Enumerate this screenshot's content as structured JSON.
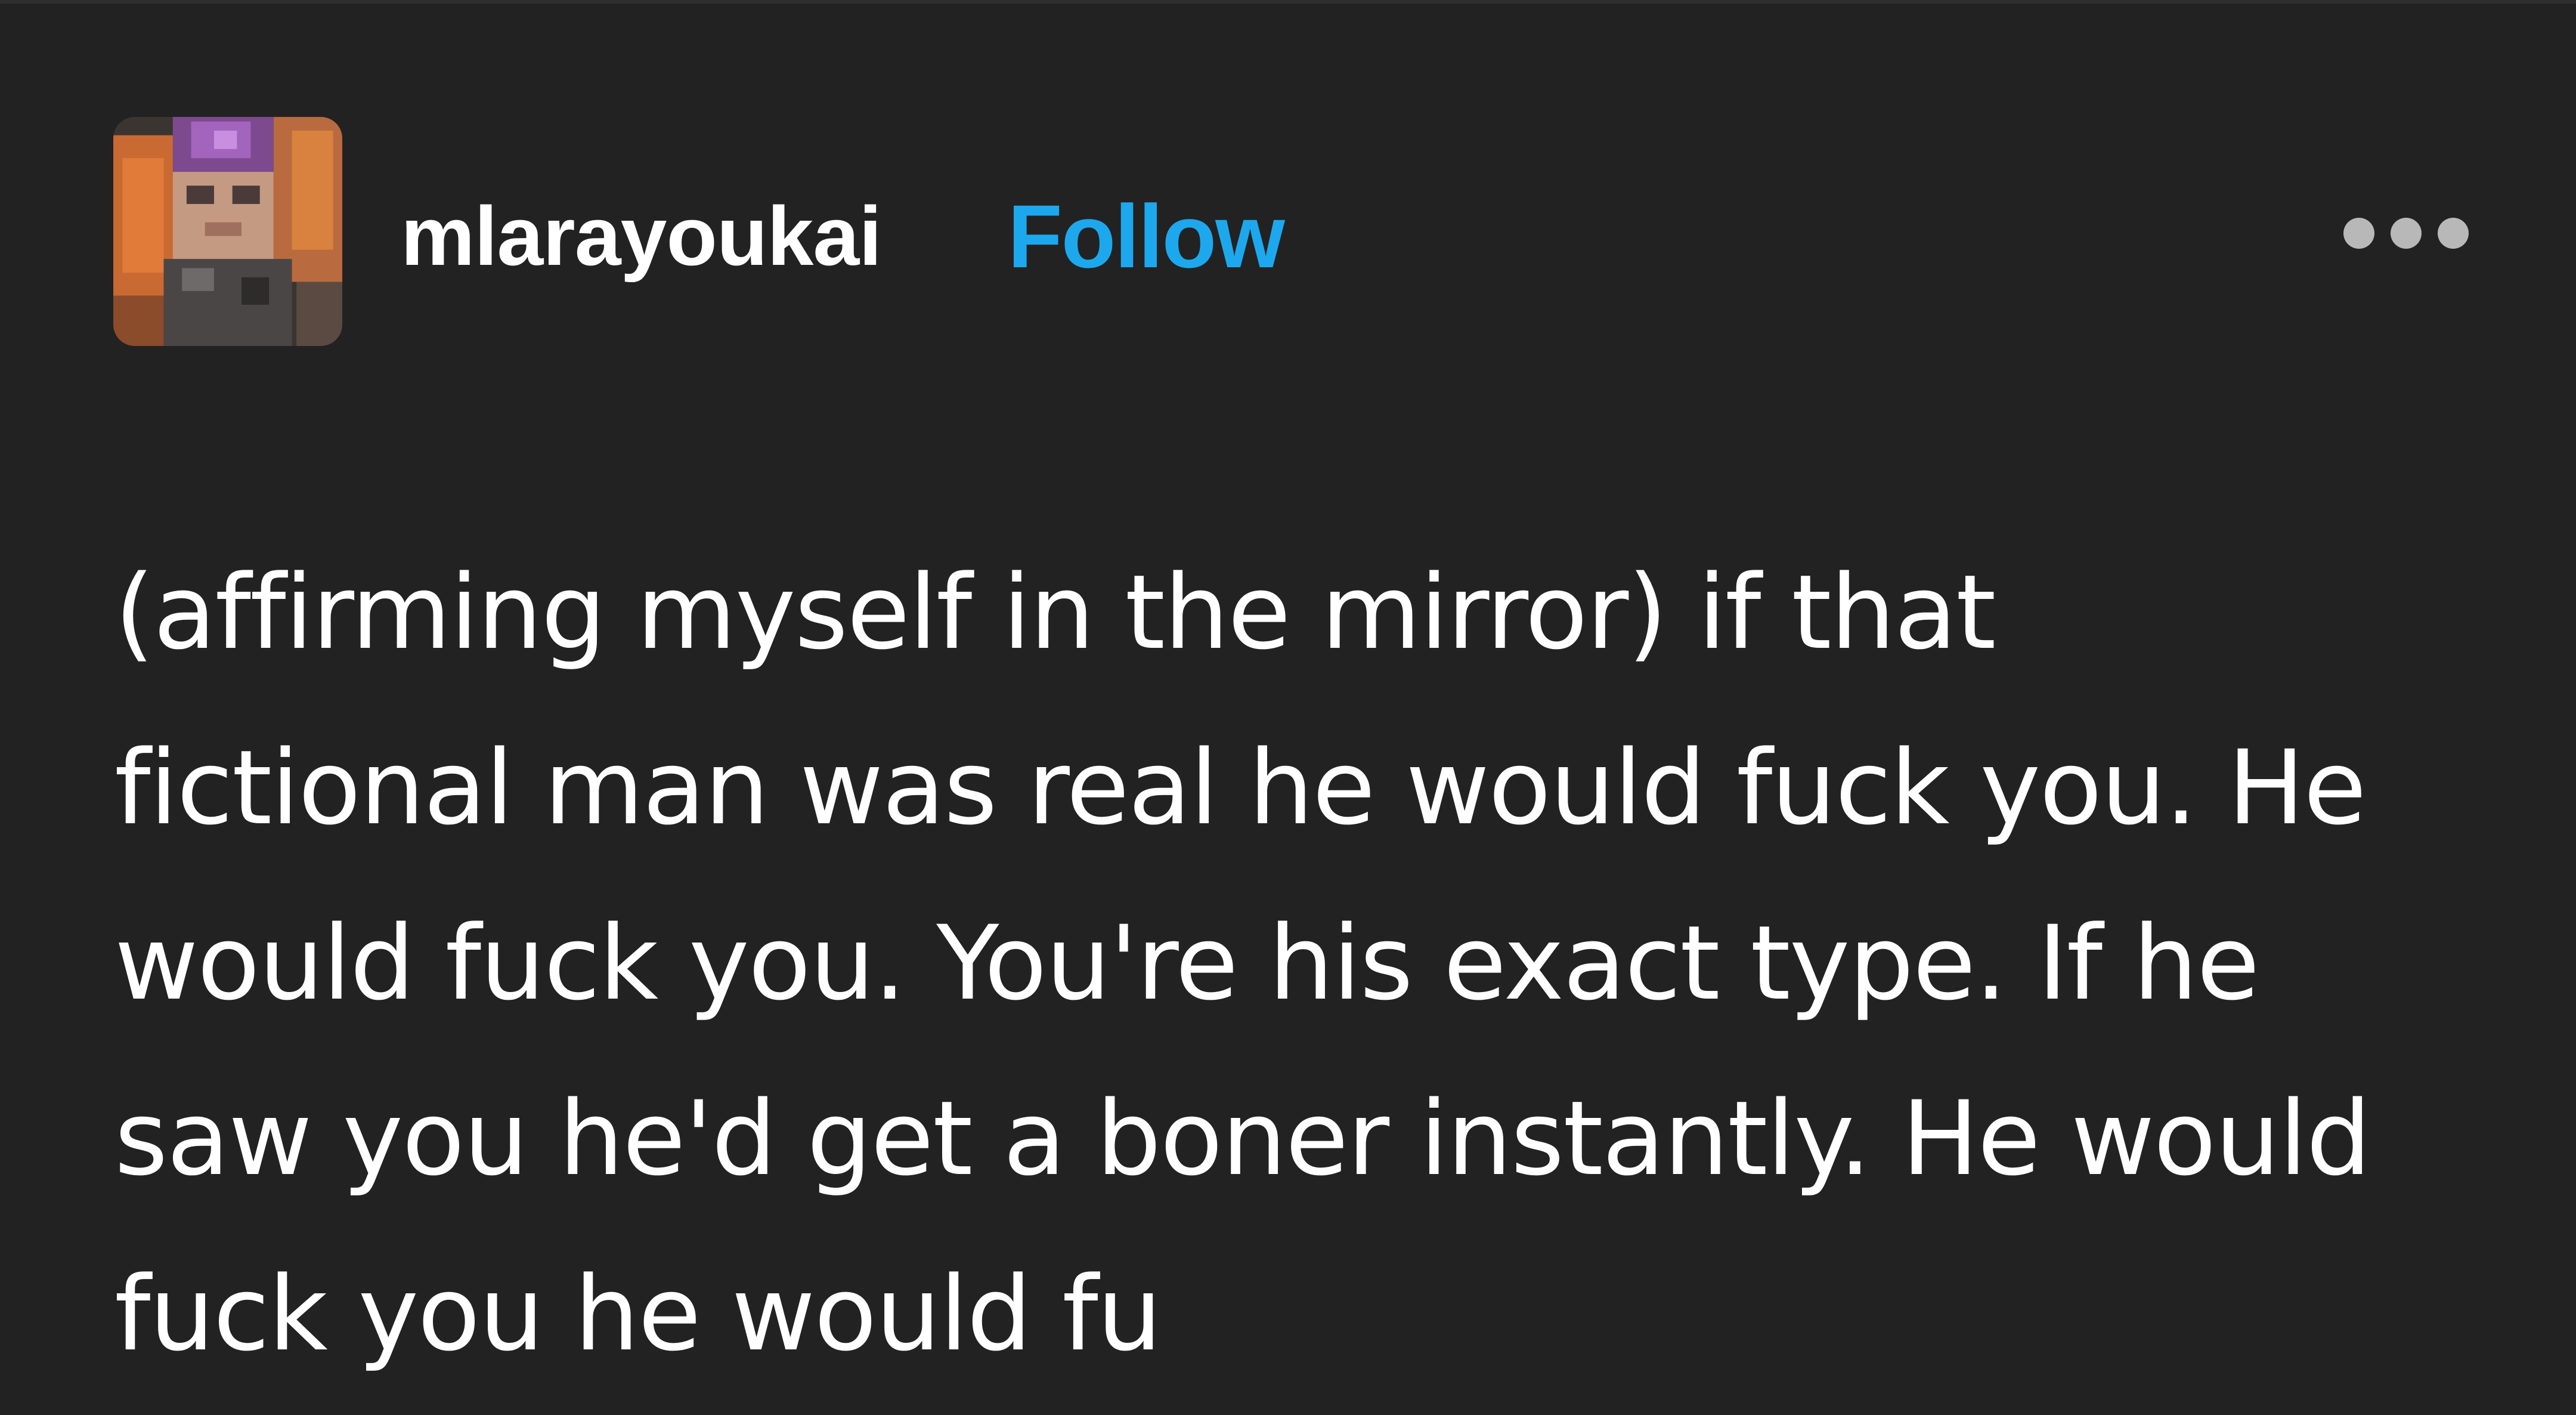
{
  "post": {
    "author": {
      "username": "mlarayoukai",
      "avatar_icon": "avatar-image"
    },
    "follow_label": "Follow",
    "more_icon": "more-options-icon",
    "body": "(affirming myself in the mirror) if that\nfictional man was real he would fuck you. He\nwould fuck you. You're his exact type. If he\nsaw you he'd get a boner instantly. He would\nfuck you he would fu"
  },
  "colors": {
    "background": "#222222",
    "text": "#ffffff",
    "follow_accent": "#1da8ee",
    "more_dots": "#b8b8b8"
  }
}
